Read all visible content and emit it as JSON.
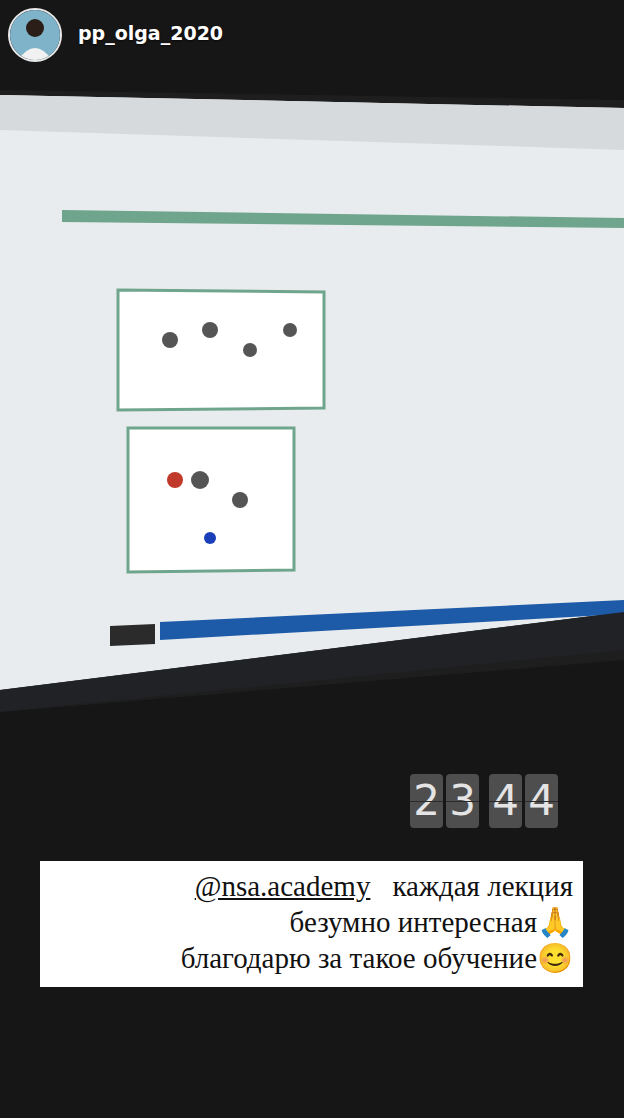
{
  "story": {
    "username": "pp_olga_2020"
  },
  "clock": {
    "hours": [
      "2",
      "3"
    ],
    "minutes": [
      "4",
      "4"
    ]
  },
  "caption": {
    "mention": "@nsa.academy",
    "lines": [
      "каждая лекция",
      "безумно интересная🙏",
      "благодарю за такое обучение😊"
    ]
  }
}
